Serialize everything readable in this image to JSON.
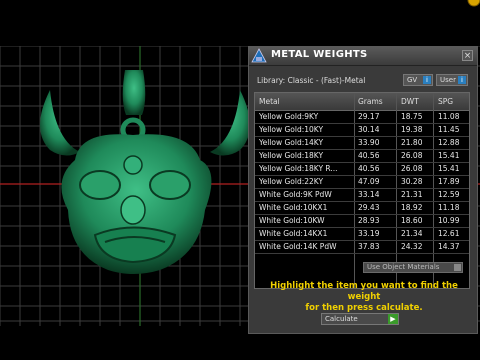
{
  "window": {
    "title": "METAL WEIGHTS",
    "close_glyph": "×"
  },
  "library": {
    "label": "Library: Classic - (Fast)-Metal"
  },
  "buttons": {
    "gv_label": "GV",
    "user_label": "User",
    "info_glyph": "i"
  },
  "table": {
    "headers": [
      "Metal",
      "Grams",
      "DWT",
      "SPG"
    ],
    "rows": [
      [
        "Yellow Gold:9KY",
        "29.17",
        "18.75",
        "11.08"
      ],
      [
        "Yellow Gold:10KY",
        "30.14",
        "19.38",
        "11.45"
      ],
      [
        "Yellow Gold:14KY",
        "33.90",
        "21.80",
        "12.88"
      ],
      [
        "Yellow Gold:18KY",
        "40.56",
        "26.08",
        "15.41"
      ],
      [
        "Yellow Gold:18KY R...",
        "40.56",
        "26.08",
        "15.41"
      ],
      [
        "Yellow Gold:22KY",
        "47.09",
        "30.28",
        "17.89"
      ],
      [
        "White Gold:9K PdW",
        "33.14",
        "21.31",
        "12.59"
      ],
      [
        "White Gold:10KX1",
        "29.43",
        "18.92",
        "11.18"
      ],
      [
        "White Gold:10KW",
        "28.93",
        "18.60",
        "10.99"
      ],
      [
        "White Gold:14KX1",
        "33.19",
        "21.34",
        "12.61"
      ],
      [
        "White Gold:14K PdW",
        "37.83",
        "24.32",
        "14.37"
      ]
    ]
  },
  "options": {
    "use_object_materials": "Use Object Materials"
  },
  "message": {
    "line1": "Highlight the item you want to find the weight",
    "line2": "for then press calculate."
  },
  "calculate": {
    "label": "Calculate",
    "go_glyph": "▶"
  },
  "colors": {
    "model": "#1f8a5a",
    "highlight_text": "#f0d000",
    "panel_bg": "#3a3a3a",
    "table_bg": "#000000"
  },
  "icons": {
    "title": "metal-weights-icon",
    "close": "close-icon",
    "dropdown": "dropdown-arrow-icon",
    "go": "play-icon"
  }
}
